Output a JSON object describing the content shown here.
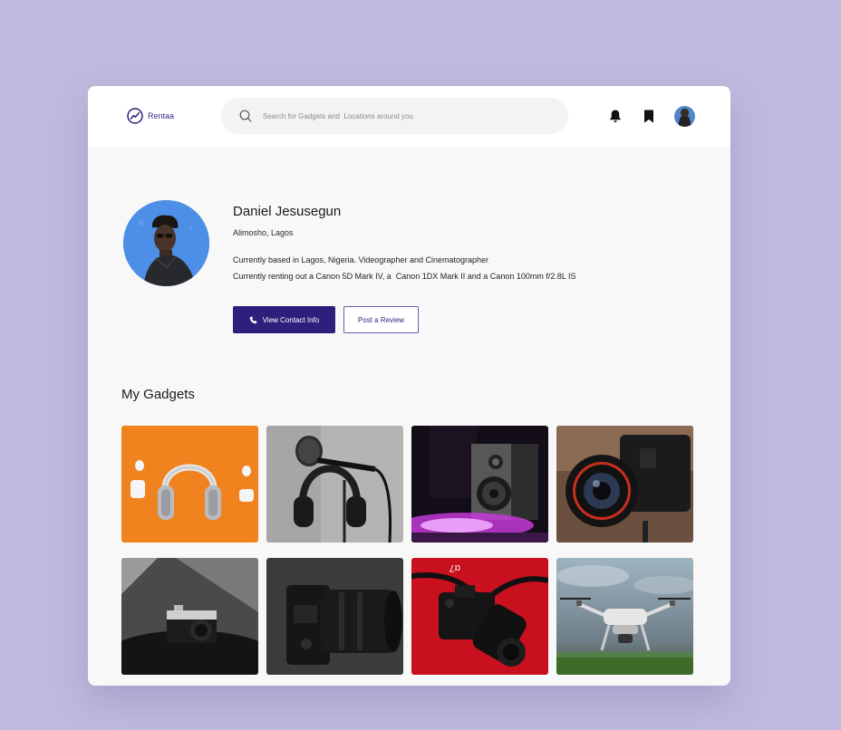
{
  "app": {
    "name": "Rentaa",
    "accent": "#2e1f7c",
    "background": "#bfbadd"
  },
  "search": {
    "placeholder": "Search for Gadgets and  Locations around you"
  },
  "header": {
    "icons": [
      "bell-icon",
      "bookmark-icon",
      "avatar"
    ]
  },
  "profile": {
    "name": "Daniel Jesusegun",
    "location": "Alimosho, Lagos",
    "bio_line1": "Currently based in Lagos, Nigeria. Videographer and Cinematographer",
    "bio_line2": "Currently renting out a Canon 5D Mark IV, a  Canon 1DX Mark II and a Canon 100mm f/2.8L IS",
    "contact_button": "View Contact Info",
    "review_button": "Post a Review"
  },
  "gadgets": {
    "title": "My Gadgets",
    "items": [
      {
        "depicts": "headphones-and-earbuds-photo"
      },
      {
        "depicts": "headphones-with-microphone-photo"
      },
      {
        "depicts": "speaker-purple-light-photo"
      },
      {
        "depicts": "camera-lens-closeup-photo"
      },
      {
        "depicts": "compact-camera-photo"
      },
      {
        "depicts": "mirrorless-camera-photo"
      },
      {
        "depicts": "camera-on-red-photo"
      },
      {
        "depicts": "drone-photo"
      }
    ]
  }
}
